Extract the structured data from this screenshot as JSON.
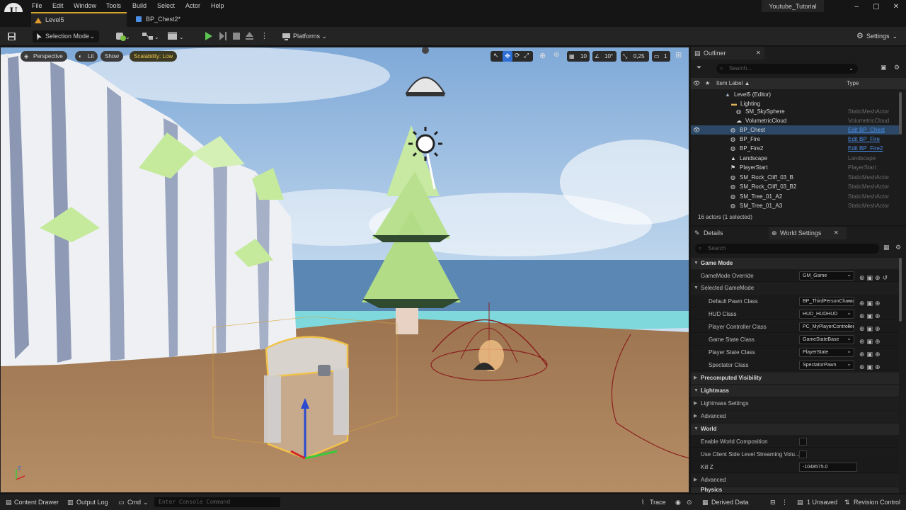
{
  "menubar": {
    "logo": "U",
    "items": [
      "File",
      "Edit",
      "Window",
      "Tools",
      "Build",
      "Select",
      "Actor",
      "Help"
    ],
    "project": "Youtube_Tutorial",
    "window_buttons": [
      "–",
      "▢",
      "✕"
    ]
  },
  "tabs": [
    {
      "label": "Level5"
    },
    {
      "label": "BP_Chest2*"
    }
  ],
  "toolbar": {
    "selection_mode": "Selection Mode",
    "platforms": "Platforms",
    "settings": "Settings"
  },
  "viewport": {
    "perspective": "Perspective",
    "lit": "Lit",
    "show": "Show",
    "scalability": "Scalability: Low",
    "grid_snap": "10",
    "rotation_snap": "10°",
    "scale_snap": "0,25",
    "camera_speed": "1",
    "axis_label": "Z",
    "colors": {
      "sky": "#9fc1e4",
      "ground": "#a47c55",
      "cliff": "#e8eaee",
      "tree": "#b8e08e",
      "water": "#7fd8dc"
    }
  },
  "outliner": {
    "title": "Outliner",
    "search_placeholder": "Search...",
    "col_label": "Item Label ▲",
    "col_type": "Type",
    "rows": [
      {
        "label": "Level5 (Editor)",
        "type": ""
      },
      {
        "label": "Lighting",
        "type": ""
      },
      {
        "label": "SM_SkySphere",
        "type": "StaticMeshActor"
      },
      {
        "label": "VolumetricCloud",
        "type": "VolumetricCloud"
      },
      {
        "label": "BP_Chest",
        "type": "Edit BP_Chest"
      },
      {
        "label": "BP_Fire",
        "type": "Edit BP_Fire"
      },
      {
        "label": "BP_Fire2",
        "type": "Edit BP_Fire2"
      },
      {
        "label": "Landscape",
        "type": "Landscape"
      },
      {
        "label": "PlayerStart",
        "type": "PlayerStart"
      },
      {
        "label": "SM_Rock_Cliff_03_B",
        "type": "StaticMeshActor"
      },
      {
        "label": "SM_Rock_Cliff_03_B2",
        "type": "StaticMeshActor"
      },
      {
        "label": "SM_Tree_01_A2",
        "type": "StaticMeshActor"
      },
      {
        "label": "SM_Tree_01_A3",
        "type": "StaticMeshActor"
      }
    ],
    "footer": "16 actors (1 selected)"
  },
  "details": {
    "tab_details": "Details",
    "tab_world": "World Settings",
    "search_placeholder": "Search",
    "cat_gamemode": "Game Mode",
    "gamemode_override_label": "GameMode Override",
    "gamemode_override_value": "GM_Game",
    "selected_gamemode": "Selected GameMode",
    "rows": [
      {
        "label": "Default Pawn Class",
        "value": "BP_ThirdPersonCharacter"
      },
      {
        "label": "HUD Class",
        "value": "HUD_HUDHUD"
      },
      {
        "label": "Player Controller Class",
        "value": "PC_MyPlayerController"
      },
      {
        "label": "Game State Class",
        "value": "GameStateBase"
      },
      {
        "label": "Player State Class",
        "value": "PlayerState"
      },
      {
        "label": "Spectator Class",
        "value": "SpectatorPawn"
      }
    ],
    "cat_precomputed": "Precomputed Visibility",
    "cat_lightmass": "Lightmass",
    "lightmass_settings": "Lightmass Settings",
    "advanced1": "Advanced",
    "cat_world": "World",
    "enable_world_composition": "Enable World Composition",
    "client_side_streaming": "Use Client Side Level Streaming Volu...",
    "kill_z_label": "Kill Z",
    "kill_z_value": "-1048575.0",
    "advanced2": "Advanced",
    "cat_physics": "Physics"
  },
  "statusbar": {
    "content_drawer": "Content Drawer",
    "output_log": "Output Log",
    "cmd": "Cmd",
    "console_placeholder": "Enter Console Command",
    "trace": "Trace",
    "derived_data": "Derived Data",
    "unsaved": "1 Unsaved",
    "revision_control": "Revision Control"
  }
}
